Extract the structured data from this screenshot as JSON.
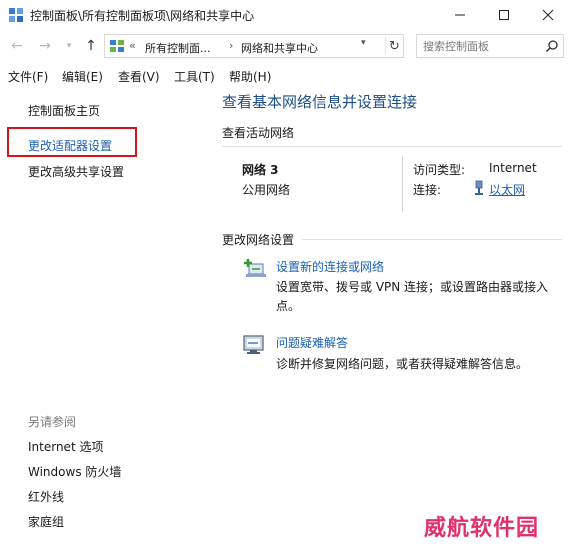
{
  "window": {
    "title": "控制面板\\所有控制面板项\\网络和共享中心"
  },
  "address": {
    "chevron": "«",
    "segment1": "所有控制面...",
    "separator": "›",
    "segment2": "网络和共享中心"
  },
  "search": {
    "placeholder": "搜索控制面板"
  },
  "menu": {
    "items": [
      "文件(F)",
      "编辑(E)",
      "查看(V)",
      "工具(T)",
      "帮助(H)"
    ]
  },
  "left": {
    "home": "控制面板主页",
    "adapter": "更改适配器设置",
    "advanced_sharing": "更改高级共享设置",
    "see_also_title": "另请参阅",
    "see_also": [
      "Internet 选项",
      "Windows 防火墙",
      "红外线",
      "家庭组"
    ]
  },
  "main": {
    "title": "查看基本网络信息并设置连接",
    "active_title": "查看活动网络",
    "network_name": "网络 3",
    "network_type": "公用网络",
    "access_label": "访问类型:",
    "access_value": "Internet",
    "connection_label": "连接:",
    "connection_value": "以太网",
    "change_title": "更改网络设置",
    "task1_link": "设置新的连接或网络",
    "task1_desc": "设置宽带、拨号或 VPN 连接；或设置路由器或接入点。",
    "task2_link": "问题疑难解答",
    "task2_desc": "诊断并修复网络问题，或者获得疑难解答信息。"
  },
  "watermark": "威航软件园",
  "colors": {
    "link": "#1a5fb4",
    "title_blue": "#1e4e8c",
    "highlight": "#d4161c",
    "watermark": "#e0306f"
  }
}
